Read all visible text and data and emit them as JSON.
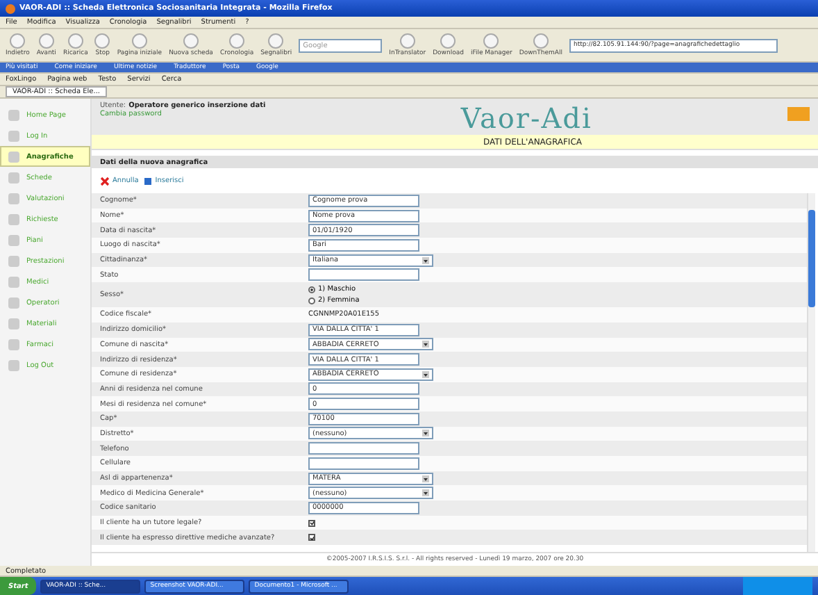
{
  "window": {
    "title": "VAOR-ADI :: Scheda Elettronica Sociosanitaria Integrata - Mozilla Firefox"
  },
  "menu": [
    "File",
    "Modifica",
    "Visualizza",
    "Cronologia",
    "Segnalibri",
    "Strumenti",
    "?"
  ],
  "toolbar": {
    "buttons": [
      "Indietro",
      "Avanti",
      "Ricarica",
      "Stop",
      "Pagina iniziale",
      "Nuova scheda",
      "Cronologia",
      "Segnalibri"
    ],
    "search": {
      "placeholder": "Google"
    },
    "addons": [
      "InTranslator",
      "Download",
      "iFile Manager",
      "DownThemAll"
    ],
    "url": "http://82.105.91.144:90/?page=anagrafichedettaglio"
  },
  "bookmarks": [
    "Più visitati",
    "Come iniziare",
    "Ultime notizie",
    "Traduttore",
    "Posta",
    "Google"
  ],
  "toolbar2": [
    "FoxLingo",
    "Pagina web",
    "Testo",
    "Servizi",
    "Cerca"
  ],
  "tab": {
    "label": "VAOR-ADI :: Scheda Ele..."
  },
  "sidebar": {
    "items": [
      {
        "label": "Home Page",
        "selected": false
      },
      {
        "label": "Log In",
        "selected": false
      },
      {
        "label": "Anagrafiche",
        "selected": true
      },
      {
        "label": "Schede",
        "selected": false
      },
      {
        "label": "Valutazioni",
        "selected": false
      },
      {
        "label": "Richieste",
        "selected": false
      },
      {
        "label": "Piani",
        "selected": false
      },
      {
        "label": "Prestazioni",
        "selected": false
      },
      {
        "label": "Medici",
        "selected": false
      },
      {
        "label": "Operatori",
        "selected": false
      },
      {
        "label": "Materiali",
        "selected": false
      },
      {
        "label": "Farmaci",
        "selected": false
      },
      {
        "label": "Log Out",
        "selected": false
      }
    ]
  },
  "header": {
    "user_label": "Utente:",
    "user": "Operatore generico inserzione dati",
    "change_password": "Cambia password",
    "logo": "Vaor-Adi",
    "page_title": "DATI DELL'ANAGRAFICA"
  },
  "form": {
    "title": "Dati della nuova anagrafica",
    "actions": [
      "Annulla",
      "Inserisci"
    ],
    "fields": [
      {
        "label": "Cognome*",
        "kind": "text",
        "value": "Cognome prova"
      },
      {
        "label": "Nome*",
        "kind": "text",
        "value": "Nome prova"
      },
      {
        "label": "Data di nascita*",
        "kind": "text",
        "value": "01/01/1920"
      },
      {
        "label": "Luogo di nascita*",
        "kind": "text",
        "value": "Bari"
      },
      {
        "label": "Cittadinanza*",
        "kind": "select",
        "value": "Italiana"
      },
      {
        "label": "Stato",
        "kind": "text"
      },
      {
        "label": "Sesso*",
        "kind": "radio",
        "options": [
          {
            "label": "1) Maschio",
            "selected": true
          },
          {
            "label": "2) Femmina",
            "selected": false
          }
        ]
      },
      {
        "label": "Codice fiscale*",
        "kind": "static",
        "value": "CGNNMP20A01E155"
      },
      {
        "label": "Indirizzo domicilio*",
        "kind": "text",
        "value": "VIA DALLA CITTA' 1"
      },
      {
        "label": "Comune di nascita*",
        "kind": "select",
        "value": "ABBADIA CERRETO"
      },
      {
        "label": "Indirizzo di residenza*",
        "kind": "text",
        "value": "VIA DALLA CITTA' 1"
      },
      {
        "label": "Comune di residenza*",
        "kind": "select",
        "value": "ABBADIA CERRETO"
      },
      {
        "label": "Anni di residenza nel comune",
        "kind": "text",
        "value": "0"
      },
      {
        "label": "Mesi di residenza nel comune*",
        "kind": "text",
        "value": "0"
      },
      {
        "label": "Cap*",
        "kind": "text",
        "value": "70100"
      },
      {
        "label": "Distretto*",
        "kind": "select",
        "value": "(nessuno)"
      },
      {
        "label": "Telefono",
        "kind": "text"
      },
      {
        "label": "Cellulare",
        "kind": "text"
      },
      {
        "label": "Asl di appartenenza*",
        "kind": "select",
        "value": "MATERA"
      },
      {
        "label": "Medico di Medicina Generale*",
        "kind": "select",
        "value": "(nessuno)"
      },
      {
        "label": "Codice sanitario",
        "kind": "text",
        "value": "0000000"
      },
      {
        "label": "Il cliente ha un tutore legale?",
        "kind": "checkbox",
        "checked": true
      },
      {
        "label": "Il cliente ha espresso direttive mediche avanzate?",
        "kind": "checkbox",
        "checked": true
      }
    ]
  },
  "footer": "©2005-2007 I.R.S.I.S. S.r.l. - All rights reserved - Lunedì 19 marzo, 2007 ore 20.30",
  "status_bar": {
    "text": "Completato"
  },
  "taskbar": {
    "start": "Start",
    "windows": [
      {
        "label": "VAOR-ADI :: Sche...",
        "selected": true
      },
      {
        "label": "Screenshot VAOR-ADI...",
        "selected": false
      },
      {
        "label": "Documento1 - Microsoft ...",
        "selected": false
      }
    ]
  }
}
